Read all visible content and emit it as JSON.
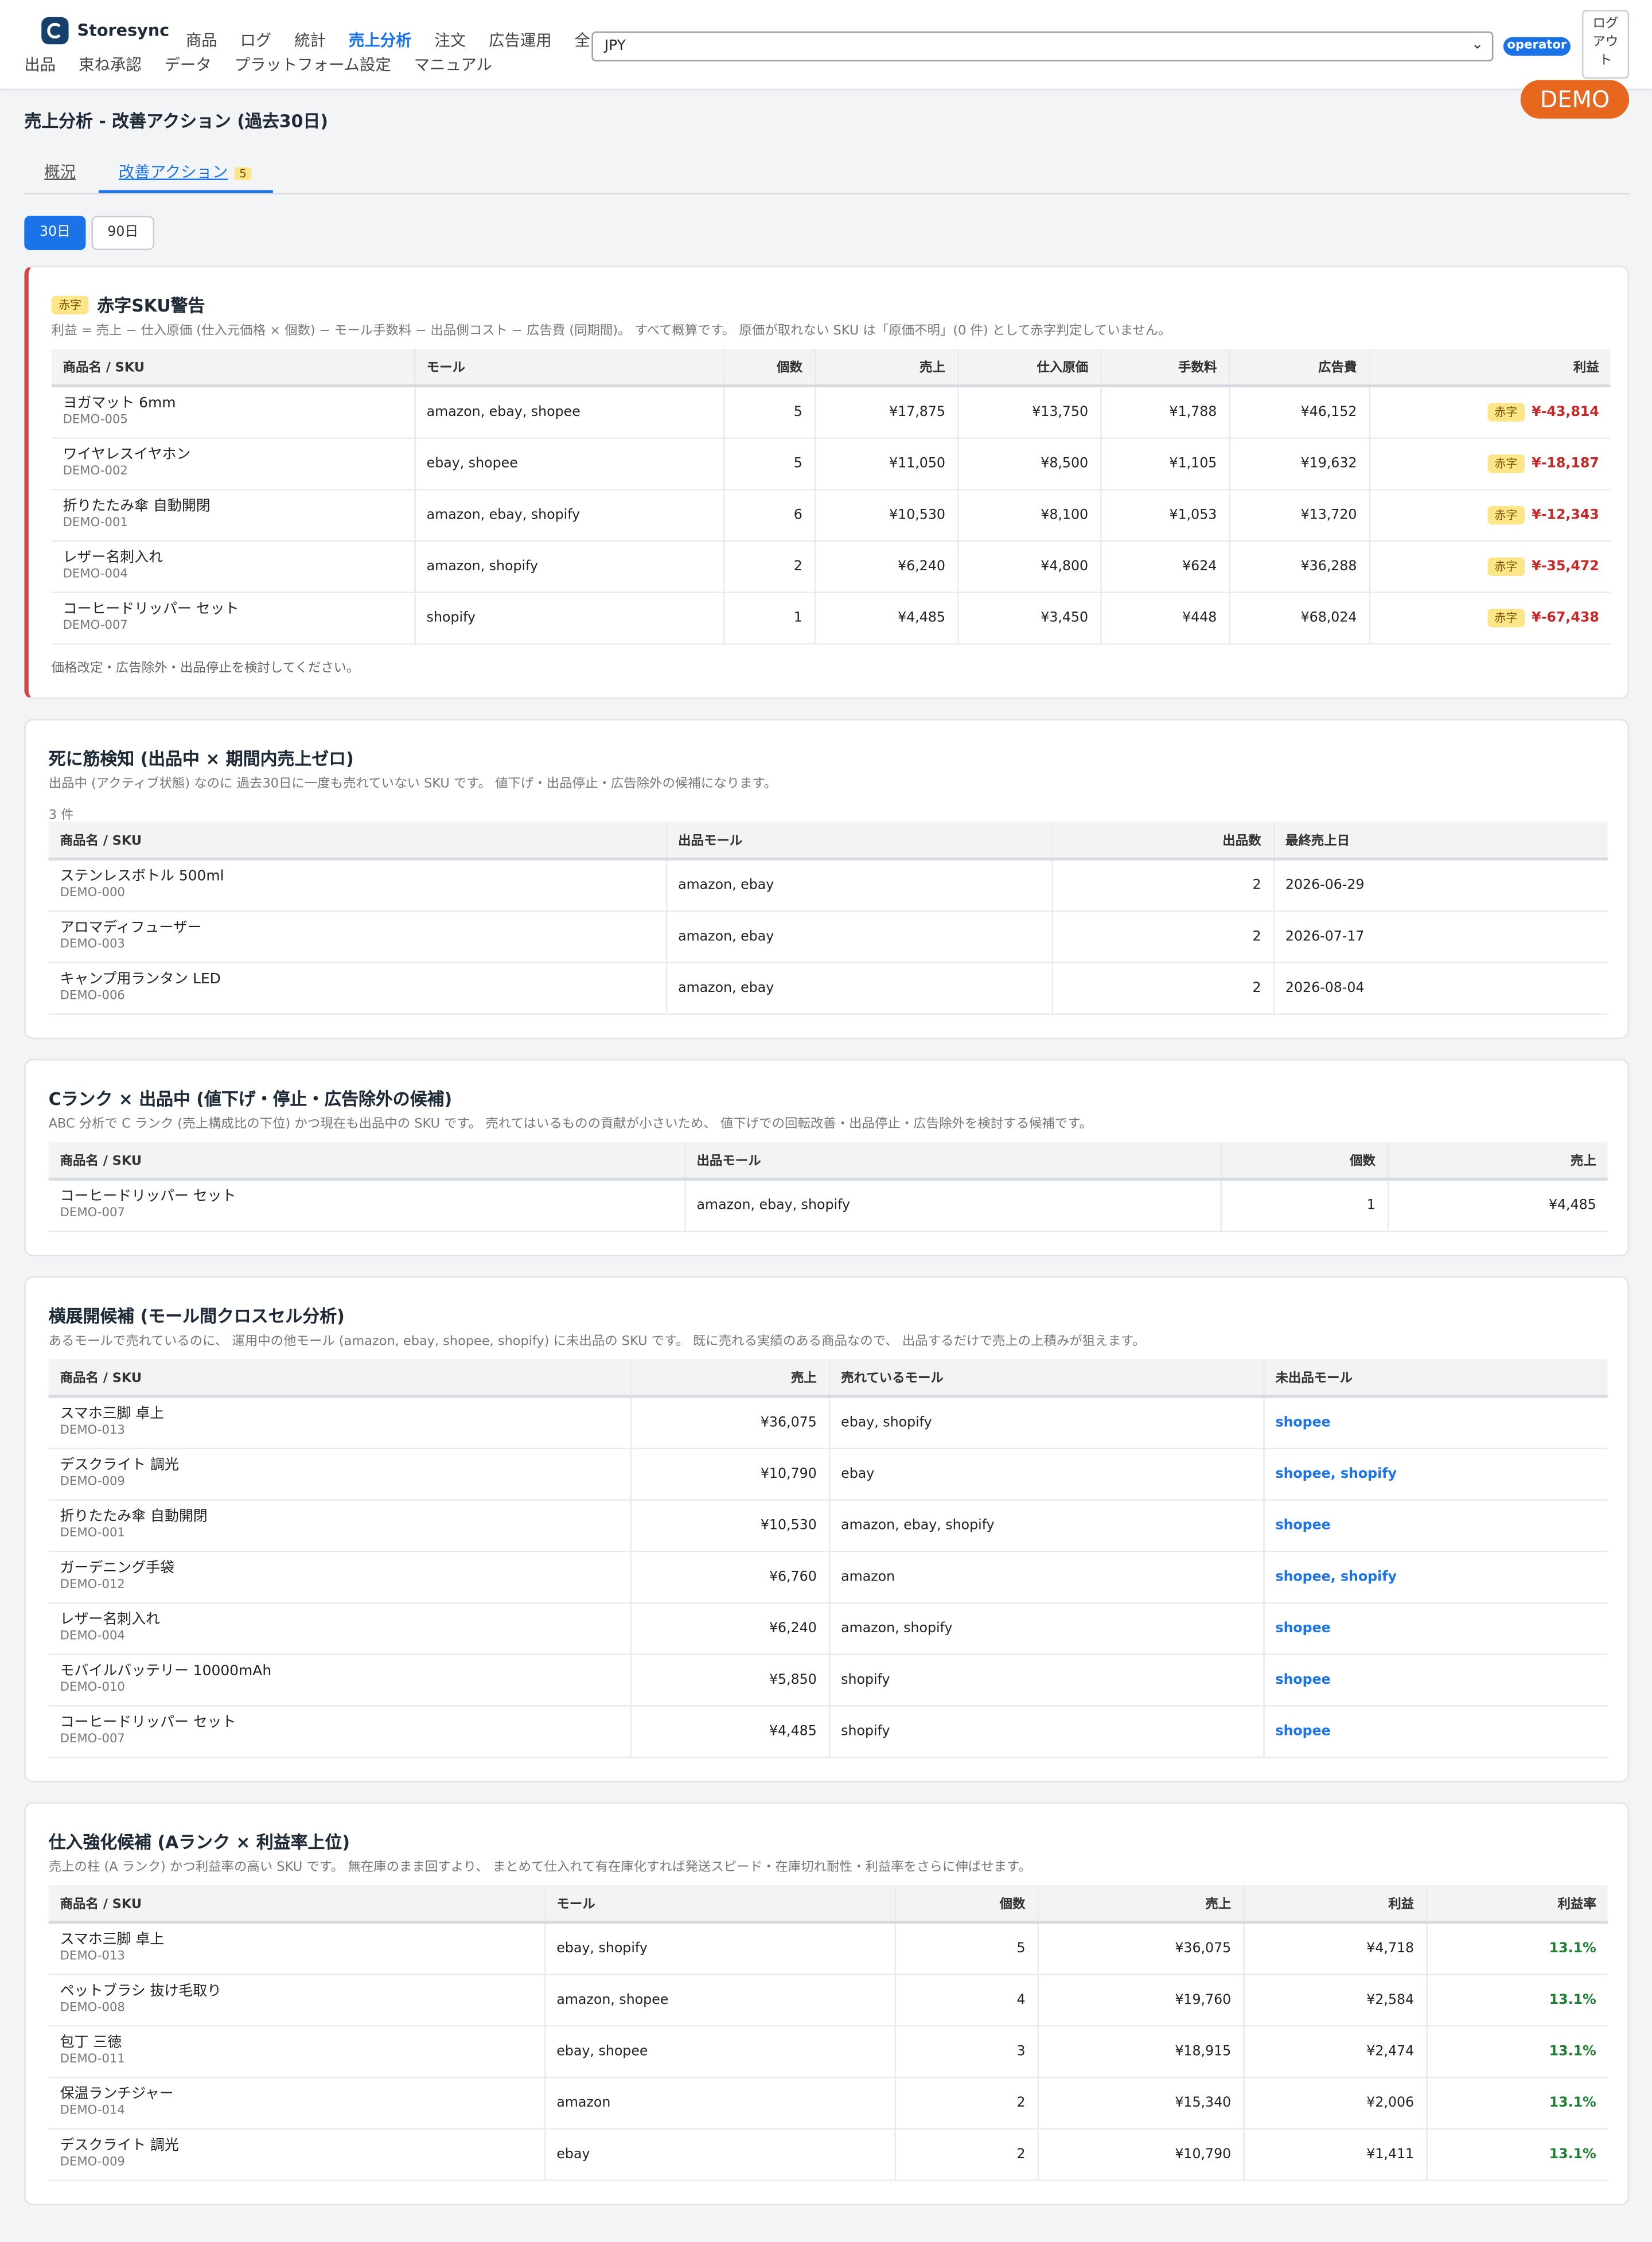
{
  "app": {
    "name": "Storesync"
  },
  "nav": {
    "row1": [
      "商品",
      "ログ",
      "統計",
      "売上分析",
      "注文",
      "広告運用",
      "全"
    ],
    "row2": [
      "出品",
      "束ね承認",
      "データ",
      "プラットフォーム設定",
      "マニュアル"
    ]
  },
  "header": {
    "currency": "JPY",
    "role": "operator",
    "logout": "ログアウト",
    "demo": "DEMO"
  },
  "page": {
    "title": "売上分析 - 改善アクション (過去30日)"
  },
  "tabs": {
    "overview": "概況",
    "actions": "改善アクション",
    "actions_count": "5"
  },
  "range": {
    "d30": "30日",
    "d90": "90日"
  },
  "loss": {
    "pill": "赤字",
    "title": "赤字SKU警告",
    "desc": "利益 = 売上 − 仕入原価 (仕入元価格 × 個数) − モール手数料 − 出品側コスト − 広告費 (同期間)。 すべて概算です。 原価が取れない SKU は「原価不明」(0 件) として赤字判定していません。",
    "headers": [
      "商品名 / SKU",
      "モール",
      "個数",
      "売上",
      "仕入原価",
      "手数料",
      "広告費",
      "利益"
    ],
    "rows": [
      {
        "name": "ヨガマット 6mm",
        "sku": "DEMO-005",
        "malls": "amazon, ebay, shopee",
        "qty": "5",
        "sales": "¥17,875",
        "cost": "¥13,750",
        "fee": "¥1,788",
        "ad": "¥46,152",
        "profit": "¥-43,814"
      },
      {
        "name": "ワイヤレスイヤホン",
        "sku": "DEMO-002",
        "malls": "ebay, shopee",
        "qty": "5",
        "sales": "¥11,050",
        "cost": "¥8,500",
        "fee": "¥1,105",
        "ad": "¥19,632",
        "profit": "¥-18,187"
      },
      {
        "name": "折りたたみ傘 自動開閉",
        "sku": "DEMO-001",
        "malls": "amazon, ebay, shopify",
        "qty": "6",
        "sales": "¥10,530",
        "cost": "¥8,100",
        "fee": "¥1,053",
        "ad": "¥13,720",
        "profit": "¥-12,343"
      },
      {
        "name": "レザー名刺入れ",
        "sku": "DEMO-004",
        "malls": "amazon, shopify",
        "qty": "2",
        "sales": "¥6,240",
        "cost": "¥4,800",
        "fee": "¥624",
        "ad": "¥36,288",
        "profit": "¥-35,472"
      },
      {
        "name": "コーヒードリッパー セット",
        "sku": "DEMO-007",
        "malls": "shopify",
        "qty": "1",
        "sales": "¥4,485",
        "cost": "¥3,450",
        "fee": "¥448",
        "ad": "¥68,024",
        "profit": "¥-67,438"
      }
    ],
    "footer": "価格改定・広告除外・出品停止を検討してください。"
  },
  "dead": {
    "title": "死に筋検知 (出品中 × 期間内売上ゼロ)",
    "desc": "出品中 (アクティブ状態) なのに 過去30日に一度も売れていない SKU です。 値下げ・出品停止・広告除外の候補になります。",
    "count": "3 件",
    "headers": [
      "商品名 / SKU",
      "出品モール",
      "出品数",
      "最終売上日"
    ],
    "rows": [
      {
        "name": "ステンレスボトル 500ml",
        "sku": "DEMO-000",
        "malls": "amazon, ebay",
        "listings": "2",
        "last": "2026-06-29"
      },
      {
        "name": "アロマディフューザー",
        "sku": "DEMO-003",
        "malls": "amazon, ebay",
        "listings": "2",
        "last": "2026-07-17"
      },
      {
        "name": "キャンプ用ランタン LED",
        "sku": "DEMO-006",
        "malls": "amazon, ebay",
        "listings": "2",
        "last": "2026-08-04"
      }
    ]
  },
  "crank": {
    "title": "Cランク × 出品中 (値下げ・停止・広告除外の候補)",
    "desc": "ABC 分析で C ランク (売上構成比の下位) かつ現在も出品中の SKU です。 売れてはいるものの貢献が小さいため、 値下げでの回転改善・出品停止・広告除外を検討する候補です。",
    "headers": [
      "商品名 / SKU",
      "出品モール",
      "個数",
      "売上"
    ],
    "rows": [
      {
        "name": "コーヒードリッパー セット",
        "sku": "DEMO-007",
        "malls": "amazon, ebay, shopify",
        "qty": "1",
        "sales": "¥4,485"
      }
    ]
  },
  "cross": {
    "title": "横展開候補 (モール間クロスセル分析)",
    "desc": "あるモールで売れているのに、 運用中の他モール (amazon, ebay, shopee, shopify) に未出品の SKU です。 既に売れる実績のある商品なので、 出品するだけで売上の上積みが狙えます。",
    "headers": [
      "商品名 / SKU",
      "売上",
      "売れているモール",
      "未出品モール"
    ],
    "rows": [
      {
        "name": "スマホ三脚 卓上",
        "sku": "DEMO-013",
        "sales": "¥36,075",
        "selling": "ebay, shopify",
        "missing": "shopee"
      },
      {
        "name": "デスクライト 調光",
        "sku": "DEMO-009",
        "sales": "¥10,790",
        "selling": "ebay",
        "missing": "shopee, shopify"
      },
      {
        "name": "折りたたみ傘 自動開閉",
        "sku": "DEMO-001",
        "sales": "¥10,530",
        "selling": "amazon, ebay, shopify",
        "missing": "shopee"
      },
      {
        "name": "ガーデニング手袋",
        "sku": "DEMO-012",
        "sales": "¥6,760",
        "selling": "amazon",
        "missing": "shopee, shopify"
      },
      {
        "name": "レザー名刺入れ",
        "sku": "DEMO-004",
        "sales": "¥6,240",
        "selling": "amazon, shopify",
        "missing": "shopee"
      },
      {
        "name": "モバイルバッテリー 10000mAh",
        "sku": "DEMO-010",
        "sales": "¥5,850",
        "selling": "shopify",
        "missing": "shopee"
      },
      {
        "name": "コーヒードリッパー セット",
        "sku": "DEMO-007",
        "sales": "¥4,485",
        "selling": "shopify",
        "missing": "shopee"
      }
    ]
  },
  "strong": {
    "title": "仕入強化候補 (Aランク × 利益率上位)",
    "desc": "売上の柱 (A ランク) かつ利益率の高い SKU です。 無在庫のまま回すより、 まとめて仕入れて有在庫化すれば発送スピード・在庫切れ耐性・利益率をさらに伸ばせます。",
    "headers": [
      "商品名 / SKU",
      "モール",
      "個数",
      "売上",
      "利益",
      "利益率"
    ],
    "rows": [
      {
        "name": "スマホ三脚 卓上",
        "sku": "DEMO-013",
        "malls": "ebay, shopify",
        "qty": "5",
        "sales": "¥36,075",
        "profit": "¥4,718",
        "rate": "13.1%"
      },
      {
        "name": "ペットブラシ 抜け毛取り",
        "sku": "DEMO-008",
        "malls": "amazon, shopee",
        "qty": "4",
        "sales": "¥19,760",
        "profit": "¥2,584",
        "rate": "13.1%"
      },
      {
        "name": "包丁 三徳",
        "sku": "DEMO-011",
        "malls": "ebay, shopee",
        "qty": "3",
        "sales": "¥18,915",
        "profit": "¥2,474",
        "rate": "13.1%"
      },
      {
        "name": "保温ランチジャー",
        "sku": "DEMO-014",
        "malls": "amazon",
        "qty": "2",
        "sales": "¥15,340",
        "profit": "¥2,006",
        "rate": "13.1%"
      },
      {
        "name": "デスクライト 調光",
        "sku": "DEMO-009",
        "malls": "ebay",
        "qty": "2",
        "sales": "¥10,790",
        "profit": "¥1,411",
        "rate": "13.1%"
      }
    ]
  }
}
